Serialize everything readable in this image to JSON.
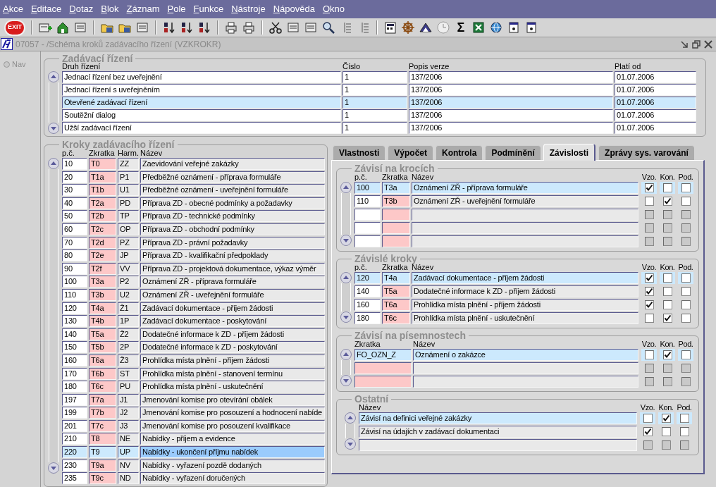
{
  "menu": [
    "Akce",
    "Editace",
    "Dotaz",
    "Blok",
    "Záznam",
    "Pole",
    "Funkce",
    "Nástroje",
    "Nápověda",
    "Okno"
  ],
  "toolbar": {
    "exit_label": "EXIT",
    "sum_label": "Σ"
  },
  "window": {
    "title": "07057 - /Schéma kroků zadávacího řízení (VZKROKR)"
  },
  "nav": {
    "label": "Nav",
    "selected": false,
    "disabled": true
  },
  "procedures": {
    "title": "Zadávací řízení",
    "columns": [
      "Druh řízení",
      "Číslo",
      "Popis verze",
      "Platí od"
    ],
    "rows": [
      {
        "cells": [
          "Jednací řízení bez uveřejnění",
          "1",
          "137/2006",
          "01.07.2006"
        ],
        "selected": false
      },
      {
        "cells": [
          "Jednací řízení s uveřejněním",
          "1",
          "137/2006",
          "01.07.2006"
        ],
        "selected": false
      },
      {
        "cells": [
          "Otevřené zadávací řízení",
          "1",
          "137/2006",
          "01.07.2006"
        ],
        "selected": true
      },
      {
        "cells": [
          "Soutěžní dialog",
          "1",
          "137/2006",
          "01.07.2006"
        ],
        "selected": false
      },
      {
        "cells": [
          "Užší zadávací řízení",
          "1",
          "137/2006",
          "01.07.2006"
        ],
        "selected": false
      }
    ]
  },
  "steps": {
    "title": "Kroky zadávacího řízení",
    "columns": [
      "p.č.",
      "Zkratka",
      "Harm.",
      "Název"
    ],
    "rows": [
      {
        "cells": [
          "10",
          "T0",
          "ZZ",
          "Zaevidování veřejné zakázky"
        ],
        "selected": false
      },
      {
        "cells": [
          "20",
          "T1a",
          "P1",
          "Předběžné oznámení - příprava formuláře"
        ],
        "selected": false
      },
      {
        "cells": [
          "30",
          "T1b",
          "U1",
          "Předběžné oznámení - uveřejnění formuláře"
        ],
        "selected": false
      },
      {
        "cells": [
          "40",
          "T2a",
          "PD",
          "Příprava ZD - obecné podmínky a požadavky"
        ],
        "selected": false
      },
      {
        "cells": [
          "50",
          "T2b",
          "TP",
          "Příprava ZD - technické podmínky"
        ],
        "selected": false
      },
      {
        "cells": [
          "60",
          "T2c",
          "OP",
          "Příprava ZD - obchodní podmínky"
        ],
        "selected": false
      },
      {
        "cells": [
          "70",
          "T2d",
          "PZ",
          "Příprava ZD - právní požadavky"
        ],
        "selected": false
      },
      {
        "cells": [
          "80",
          "T2e",
          "JP",
          "Příprava ZD - kvalifikační předpoklady"
        ],
        "selected": false
      },
      {
        "cells": [
          "90",
          "T2f",
          "VV",
          "Příprava ZD - projektová dokumentace, výkaz výměr"
        ],
        "selected": false
      },
      {
        "cells": [
          "100",
          "T3a",
          "P2",
          "Oznámení ZŘ - příprava formuláře"
        ],
        "selected": false
      },
      {
        "cells": [
          "110",
          "T3b",
          "U2",
          "Oznámení ZŘ - uveřejnění formuláře"
        ],
        "selected": false
      },
      {
        "cells": [
          "120",
          "T4a",
          "Ž1",
          "Zadávací dokumentace - příjem žádosti"
        ],
        "selected": false
      },
      {
        "cells": [
          "130",
          "T4b",
          "1P",
          "Zadávací dokumentace - poskytování"
        ],
        "selected": false
      },
      {
        "cells": [
          "140",
          "T5a",
          "Ž2",
          "Dodatečné informace k ZD - příjem žádosti"
        ],
        "selected": false
      },
      {
        "cells": [
          "150",
          "T5b",
          "2P",
          "Dodatečné informace k ZD - poskytování"
        ],
        "selected": false
      },
      {
        "cells": [
          "160",
          "T6a",
          "Ž3",
          "Prohlídka místa plnění - příjem žádosti"
        ],
        "selected": false
      },
      {
        "cells": [
          "170",
          "T6b",
          "ST",
          "Prohlídka místa plnění - stanovení termínu"
        ],
        "selected": false
      },
      {
        "cells": [
          "180",
          "T6c",
          "PU",
          "Prohlídka místa plnění - uskutečnění"
        ],
        "selected": false
      },
      {
        "cells": [
          "197",
          "T7a",
          "J1",
          "Jmenování komise pro otevírání obálek"
        ],
        "selected": false
      },
      {
        "cells": [
          "199",
          "T7b",
          "J2",
          "Jmenování komise pro posouzení a hodnocení nabíde"
        ],
        "selected": false
      },
      {
        "cells": [
          "201",
          "T7c",
          "J3",
          "Jmenování komise pro posouzení kvalifikace"
        ],
        "selected": false
      },
      {
        "cells": [
          "210",
          "T8",
          "NE",
          "Nabídky - příjem a evidence"
        ],
        "selected": false
      },
      {
        "cells": [
          "220",
          "T9",
          "UP",
          "Nabídky - ukončení příjmu nabídek"
        ],
        "selected": true
      },
      {
        "cells": [
          "230",
          "T9a",
          "NV",
          "Nabídky - vyřazení pozdě dodaných"
        ],
        "selected": false
      },
      {
        "cells": [
          "235",
          "T9c",
          "ND",
          "Nabídky - vyřazení doručených"
        ],
        "selected": false
      }
    ]
  },
  "tabs": [
    {
      "label": "Vlastnosti",
      "selected": false
    },
    {
      "label": "Výpočet",
      "selected": false
    },
    {
      "label": "Kontrola",
      "selected": false
    },
    {
      "label": "Podmínění",
      "selected": false
    },
    {
      "label": "Závislosti",
      "selected": true
    },
    {
      "label": "Zprávy sys. varování",
      "selected": false
    }
  ],
  "depends_on_steps": {
    "title": "Závisí na krocích",
    "columns": [
      "p.č.",
      "Zkratka",
      "Název"
    ],
    "flag_columns": [
      "Vzo.",
      "Kon.",
      "Pod."
    ],
    "rows": [
      {
        "cells": [
          "100",
          "T3a",
          "Oznámení ZŘ - příprava formuláře"
        ],
        "selected": true,
        "disabled": false,
        "vzo": true,
        "kon": false,
        "pod": false
      },
      {
        "cells": [
          "110",
          "T3b",
          "Oznámení ZŘ - uveřejnění formuláře"
        ],
        "selected": false,
        "disabled": false,
        "vzo": false,
        "kon": true,
        "pod": false
      },
      {
        "disabled": true
      },
      {
        "disabled": true
      },
      {
        "disabled": true
      }
    ]
  },
  "dependent_steps": {
    "title": "Závislé kroky",
    "columns": [
      "p.č.",
      "Zkratka",
      "Název"
    ],
    "flag_columns": [
      "Vzo.",
      "Kon.",
      "Pod."
    ],
    "rows": [
      {
        "cells": [
          "120",
          "T4a",
          "Zadávací dokumentace - příjem žádosti"
        ],
        "selected": true,
        "disabled": false,
        "vzo": true,
        "kon": false,
        "pod": false
      },
      {
        "cells": [
          "140",
          "T5a",
          "Dodatečné informace k ZD - příjem žádosti"
        ],
        "selected": false,
        "disabled": false,
        "vzo": true,
        "kon": false,
        "pod": false
      },
      {
        "cells": [
          "160",
          "T6a",
          "Prohlídka místa plnění - příjem žádosti"
        ],
        "selected": false,
        "disabled": false,
        "vzo": true,
        "kon": false,
        "pod": false
      },
      {
        "cells": [
          "180",
          "T6c",
          "Prohlídka místa plnění - uskutečnění"
        ],
        "selected": false,
        "disabled": false,
        "vzo": false,
        "kon": true,
        "pod": false
      }
    ]
  },
  "depends_on_documents": {
    "title": "Závisí na písemnostech",
    "columns": [
      "Zkratka",
      "Název"
    ],
    "flag_columns": [
      "Vzo.",
      "Kon.",
      "Pod."
    ],
    "rows": [
      {
        "cells": [
          "FO_OZN_Z",
          "Oznámení o zakázce"
        ],
        "selected": true,
        "disabled": false,
        "vzo": false,
        "kon": true,
        "pod": false
      },
      {
        "disabled": true
      },
      {
        "disabled": true
      }
    ]
  },
  "other": {
    "title": "Ostatní",
    "columns": [
      "Název"
    ],
    "flag_columns": [
      "Vzo.",
      "Kon.",
      "Pod."
    ],
    "rows": [
      {
        "cells": [
          "Závisí na definici veřejné zakázky"
        ],
        "selected": true,
        "disabled": false,
        "vzo": false,
        "kon": true,
        "pod": false
      },
      {
        "cells": [
          "Závisí na údajích v zadávací dokumentaci"
        ],
        "selected": false,
        "disabled": false,
        "vzo": true,
        "kon": false,
        "pod": false
      },
      {
        "disabled": true
      }
    ]
  }
}
